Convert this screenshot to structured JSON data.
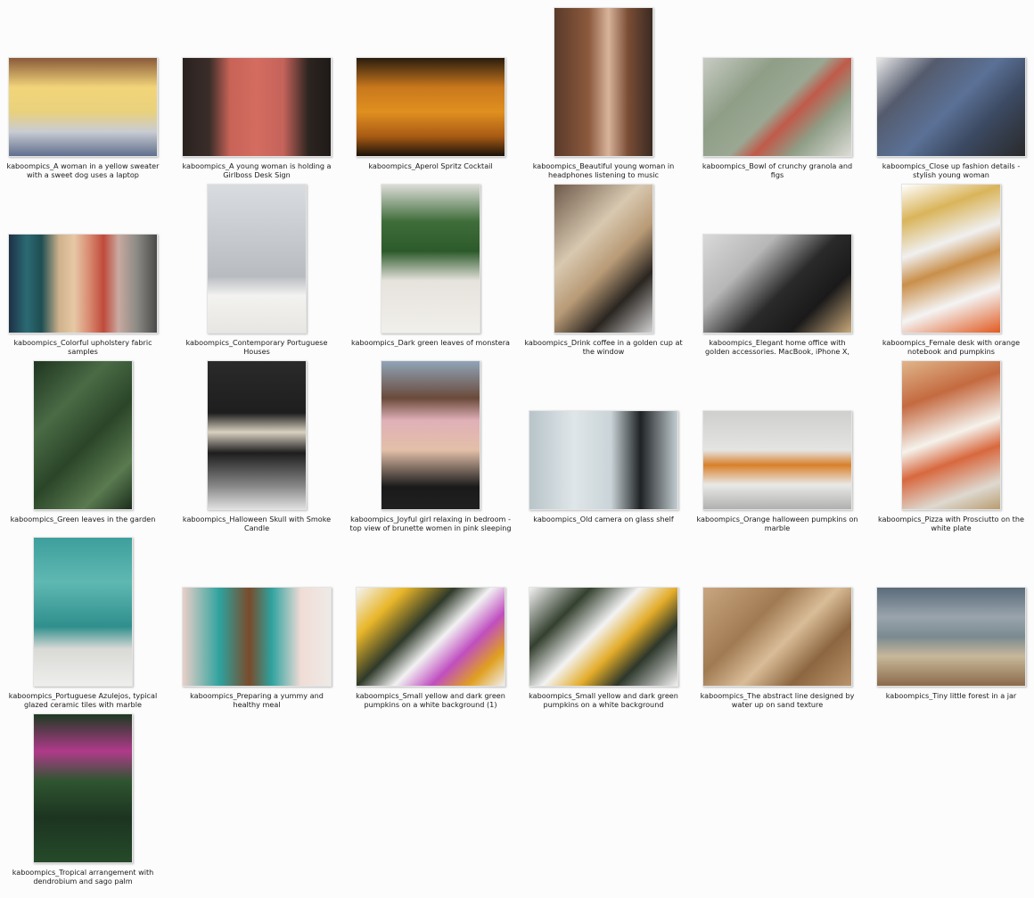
{
  "items": [
    {
      "name": "kaboompics_A woman in a yellow sweater with a sweet dog uses a laptop",
      "orient": "land",
      "gradient": "linear-gradient(180deg,#8a5a3a 0%,#f2d57a 30%,#e9d17c 55%,#c9ccd3 75%,#5f6f8d 100%)"
    },
    {
      "name": "kaboompics_A young woman is holding a Girlboss Desk Sign",
      "orient": "land",
      "gradient": "linear-gradient(90deg,#2a2220 0%,#3a2d29 18%,#c96357 32%,#d46c60 50%,#c4635a 68%,#2c2420 85%,#1f1a18 100%)"
    },
    {
      "name": "kaboompics_Aperol Spritz Cocktail",
      "orient": "land",
      "gradient": "linear-gradient(180deg,#2a1c0e 0%,#c9781d 30%,#e0901f 55%,#a85a14 80%,#1a120a 100%)"
    },
    {
      "name": "kaboompics_Beautiful young woman in headphones listening to music",
      "orient": "port",
      "gradient": "linear-gradient(90deg,#5a3a2a 0%,#8c5a3d 35%,#d8b39a 55%,#7a4d35 75%,#3a2a22 100%)"
    },
    {
      "name": "kaboompics_Bowl of crunchy granola and figs",
      "orient": "land",
      "gradient": "linear-gradient(135deg,#c8ccc3 0%,#8f9e87 30%,#9aa893 50%,#c05a4a 60%,#8f9e87 75%,#dcdcd6 100%)"
    },
    {
      "name": "kaboompics_Close up fashion details - stylish young woman",
      "orient": "land",
      "gradient": "linear-gradient(135deg,#e8e8e8 0%,#545b6d 25%,#5b7196 50%,#3c4a63 70%,#2a2a2a 100%)"
    },
    {
      "name": "kaboompics_Colorful upholstery fabric samples",
      "orient": "land",
      "gradient": "linear-gradient(90deg,#1c3146 0%,#2b6a73 12%,#1e4e52 22%,#cfb28c 34%,#e6c8a5 44%,#d98c73 54%,#bf4a3a 64%,#c9a9a0 74%,#8e8c86 86%,#4a4a4a 100%)"
    },
    {
      "name": "kaboompics_Contemporary Portuguese Houses",
      "orient": "port",
      "gradient": "linear-gradient(180deg,#d9dcdf 0%,#c4c8cd 40%,#b8bcc1 62%,#f2f2f0 75%,#e8e6e2 100%)"
    },
    {
      "name": "kaboompics_Dark green leaves of monstera",
      "orient": "port",
      "gradient": "linear-gradient(180deg,#dcdcd8 0%,#3f6d3a 25%,#2c5a2a 45%,#e6e3dd 65%,#f1efea 100%)"
    },
    {
      "name": "kaboompics_Drink coffee in a golden cup at the window",
      "orient": "port",
      "gradient": "linear-gradient(135deg,#6e5a4a 0%,#d8c8b0 35%,#b89a76 55%,#2a2520 75%,#d0d0d0 100%)"
    },
    {
      "name": "kaboompics_Elegant home office with golden accessories. MacBook, iPhone X, watch",
      "orient": "land",
      "gradient": "linear-gradient(135deg,#d9d9d9 0%,#b7b7b7 30%,#2a2a2a 55%,#1a1a1a 75%,#c8a87a 100%)"
    },
    {
      "name": "kaboompics_Female desk with orange notebook and pumpkins",
      "orient": "port",
      "gradient": "linear-gradient(160deg,#ffffff 0%,#d9b45a 20%,#f0f0f0 40%,#c98f4a 55%,#f4f4f4 75%,#e15a20 100%)"
    },
    {
      "name": "kaboompics_Green leaves in the garden",
      "orient": "port",
      "gradient": "linear-gradient(135deg,#1f3520 0%,#4a6b45 30%,#2a4528 55%,#5a7a50 80%,#1b2e1c 100%)"
    },
    {
      "name": "kaboompics_Halloween Skull with Smoke Candle",
      "orient": "port",
      "gradient": "linear-gradient(180deg,#2a2a2a 0%,#1e1e1e 35%,#d8d0c0 48%,#1e1e1e 62%,#8a8a8a 85%,#e0e0e0 100%)"
    },
    {
      "name": "kaboompics_Joyful girl relaxing in bedroom - top view of brunette women in pink sleeping mask",
      "orient": "port",
      "gradient": "linear-gradient(180deg,#8fa4b8 0%,#6a4a3a 25%,#e0b0b8 40%,#e3bfa8 60%,#1a1a1a 85%,#202020 100%)"
    },
    {
      "name": "kaboompics_Old camera on glass shelf",
      "orient": "land",
      "gradient": "linear-gradient(90deg,#b8c4c9 0%,#dfe6e9 30%,#cad4d8 55%,#1e2224 75%,#c3cdd1 100%)"
    },
    {
      "name": "kaboompics_Orange halloween pumpkins on marble",
      "orient": "land",
      "gradient": "linear-gradient(180deg,#cfcfcd 0%,#e4e4e2 40%,#d9802a 55%,#e9e9e7 75%,#b0b0ae 100%)"
    },
    {
      "name": "kaboompics_Pizza with Prosciutto on the white plate",
      "orient": "port",
      "gradient": "linear-gradient(160deg,#e0b58a 0%,#c46a40 25%,#f5f2ec 50%,#d8683e 65%,#ded9d0 85%,#b89c70 100%)"
    },
    {
      "name": "kaboompics_Portuguese Azulejos, typical glazed ceramic tiles with marble",
      "orient": "port",
      "gradient": "linear-gradient(180deg,#3e9f9c 0%,#5fb8b2 30%,#2f8f8c 60%,#d9d9d6 75%,#eeeeec 100%)"
    },
    {
      "name": "kaboompics_Preparing a yummy and healthy meal",
      "orient": "land",
      "gradient": "linear-gradient(90deg,#e9cfc8 0%,#2ea29e 25%,#7a4a2a 45%,#2ea29e 60%,#f1dcd6 80%,#eeeae6 100%)"
    },
    {
      "name": "kaboompics_Small yellow and dark green pumpkins on a white background (1)",
      "orient": "land",
      "gradient": "linear-gradient(135deg,#f4f4f4 0%,#e8b62a 20%,#2f3a2a 40%,#f2f2f2 55%,#c04fc0 70%,#e0a020 85%,#f0f0f0 100%)"
    },
    {
      "name": "kaboompics_Small yellow and dark green pumpkins on a white background",
      "orient": "land",
      "gradient": "linear-gradient(135deg,#f2f2f2 0%,#34402f 25%,#f3f3f3 45%,#e3ac2a 60%,#2d372b 75%,#f1f1f1 100%)"
    },
    {
      "name": "kaboompics_The abstract line designed by water up on sand texture",
      "orient": "land",
      "gradient": "linear-gradient(135deg,#c9a680 0%,#a07a52 35%,#d9bd98 55%,#8c6640 75%,#b8936a 100%)"
    },
    {
      "name": "kaboompics_Tiny little forest in a jar",
      "orient": "land",
      "gradient": "linear-gradient(180deg,#5a6b7a 0%,#9aa4ad 30%,#7a8a90 50%,#c8b89a 70%,#8a6a4a 100%)"
    },
    {
      "name": "kaboompics_Tropical arrangement with dendrobium and sago palm",
      "orient": "port",
      "gradient": "linear-gradient(180deg,#1e3a22 0%,#b03a8a 25%,#2f5530 45%,#1c3420 70%,#264a2a 100%)"
    }
  ]
}
